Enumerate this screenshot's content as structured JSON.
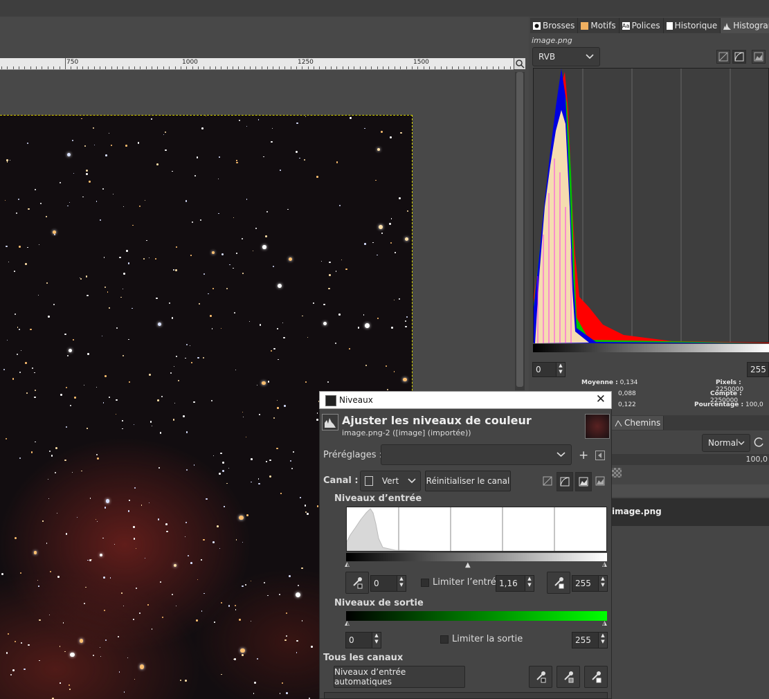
{
  "ruler": {
    "labels": [
      "750",
      "1000",
      "1250",
      "1500"
    ]
  },
  "dock": {
    "tabs": [
      {
        "label": "Brosses"
      },
      {
        "label": "Motifs"
      },
      {
        "label": "Polices"
      },
      {
        "label": "Historique"
      },
      {
        "label": "Histogramme"
      }
    ],
    "histogram": {
      "file": "image.png",
      "channel": "RVB",
      "range_min": "0",
      "range_max": "255",
      "stats": {
        "mean_label": "Moyenne :",
        "mean": "0,134",
        "std": "0,088",
        "median": "0,122",
        "pixels_label": "Pixels :",
        "pixels": "2250000",
        "count_label": "Compte :",
        "count": "2250000",
        "percent_label": "Pourcentage :",
        "percent": "100,0"
      }
    },
    "layers": {
      "paths_tab": "Chemins",
      "mode": "Normal",
      "opacity": "100,0",
      "layer_name": "image.png"
    }
  },
  "dialog": {
    "window_title": "Niveaux",
    "heading": "Ajuster les niveaux de couleur",
    "subheading": "image.png-2 ([image] (importée))",
    "presets_label": "Préréglages :",
    "presets_value": "",
    "channel_label": "Canal :",
    "channel_value": "Vert",
    "reset_channel": "Réinitialiser le canal",
    "input_levels_label": "Niveaux d’entrée",
    "input_low": "0",
    "clamp_input_label": "Limiter l’entrée",
    "gamma": "1,16",
    "input_high": "255",
    "output_levels_label": "Niveaux de sortie",
    "output_low": "0",
    "clamp_output_label": "Limiter la sortie",
    "output_high": "255",
    "all_channels_label": "Tous les canaux",
    "auto_input_button": "Niveaux d’entrée automatiques"
  }
}
